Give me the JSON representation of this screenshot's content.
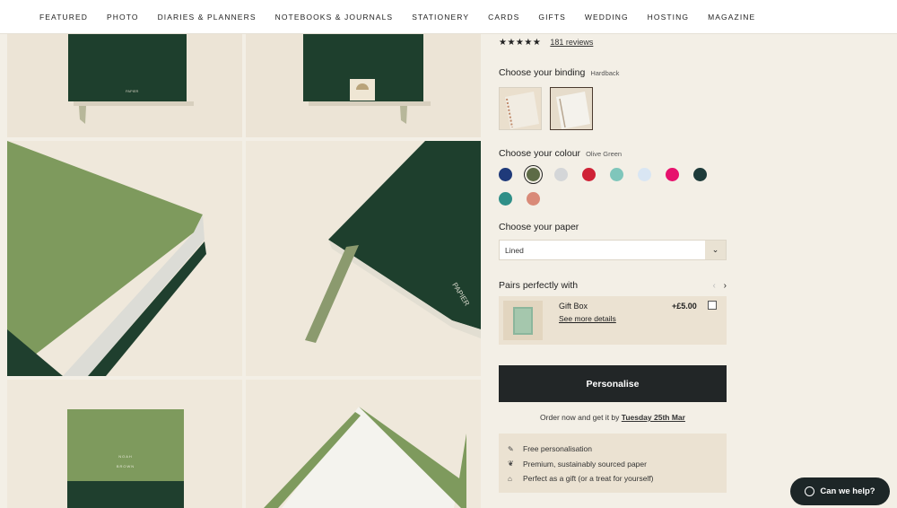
{
  "nav": {
    "items": [
      "FEATURED",
      "PHOTO",
      "DIARIES & PLANNERS",
      "NOTEBOOKS & JOURNALS",
      "STATIONERY",
      "CARDS",
      "GIFTS",
      "WEDDING",
      "HOSTING",
      "MAGAZINE"
    ]
  },
  "gallery": {
    "cover_brand": "PAPIER",
    "tile5_cover_name": [
      "NOAH",
      "BROWN"
    ]
  },
  "product": {
    "rating": 4.5,
    "stars_glyph": "★★★★★",
    "reviews_link": "181 reviews",
    "binding": {
      "title": "Choose your binding",
      "selected": "Hardback"
    },
    "colour": {
      "title": "Choose your colour",
      "selected": "Olive Green",
      "swatches": [
        "#1f3a7a",
        "#5d6b46",
        "#d4d6d8",
        "#cf2236",
        "#7fc6bb",
        "#d9e6f3",
        "#e6126d",
        "#1e3b3a",
        "#2f8f88",
        "#d98a78"
      ],
      "selected_index": 1
    },
    "paper": {
      "title": "Choose your paper",
      "value": "Lined"
    },
    "pairs": {
      "title": "Pairs perfectly with",
      "item_name": "Gift Box",
      "item_link": "See more details",
      "item_price": "+£5.00"
    },
    "personalise_label": "Personalise",
    "order": {
      "prefix": "Order now and get it by",
      "date": "Tuesday 25th Mar"
    },
    "perks": [
      "Free personalisation",
      "Premium, sustainably sourced paper",
      "Perfect as a gift (or a treat for yourself)"
    ]
  },
  "help": {
    "label": "Can we help?"
  },
  "colors": {
    "accent_dark": "#222627",
    "background": "#f3efe6",
    "olive": "#7d9a5a",
    "forest": "#1f4030"
  }
}
